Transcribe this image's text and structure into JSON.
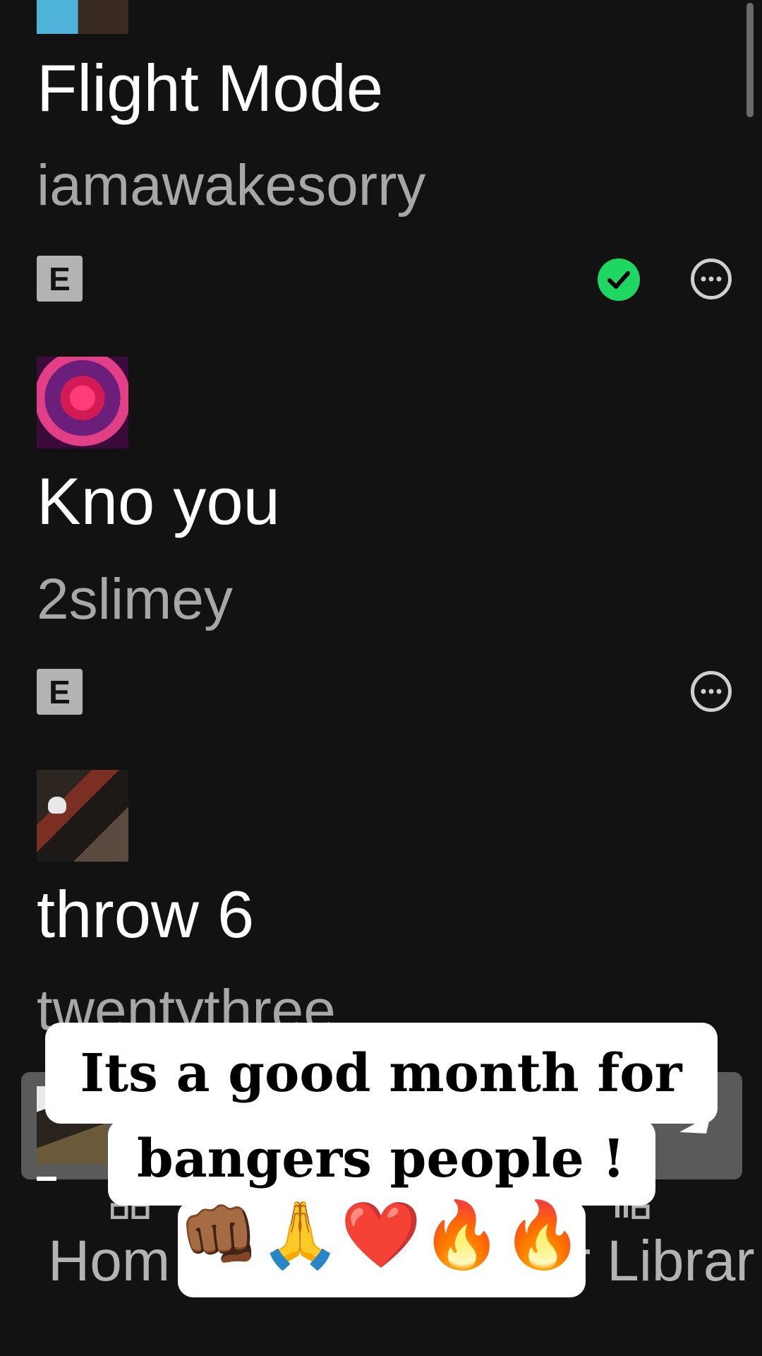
{
  "tracks": [
    {
      "title": "Flight Mode",
      "artist": "iamawakesorry",
      "explicit_label": "E",
      "saved": true
    },
    {
      "title": "Kno you",
      "artist": "2slimey",
      "explicit_label": "E",
      "saved": false
    },
    {
      "title": "throw 6",
      "artist": "twentythree"
    }
  ],
  "icons": {
    "saved": "check-circle-icon",
    "more": "more-options-icon",
    "play": "play-icon",
    "home": "home-icon",
    "library": "library-icon"
  },
  "colors": {
    "background": "#121212",
    "accent_green": "#1ed760",
    "secondary_text": "#a7a7a7"
  },
  "nav": {
    "home_label": "Hom",
    "library_label": "r Librar"
  },
  "caption": {
    "line1": "Its a good month for",
    "line2": "bangers people !",
    "line3": "👊🏾🙏❤️🔥🔥"
  }
}
